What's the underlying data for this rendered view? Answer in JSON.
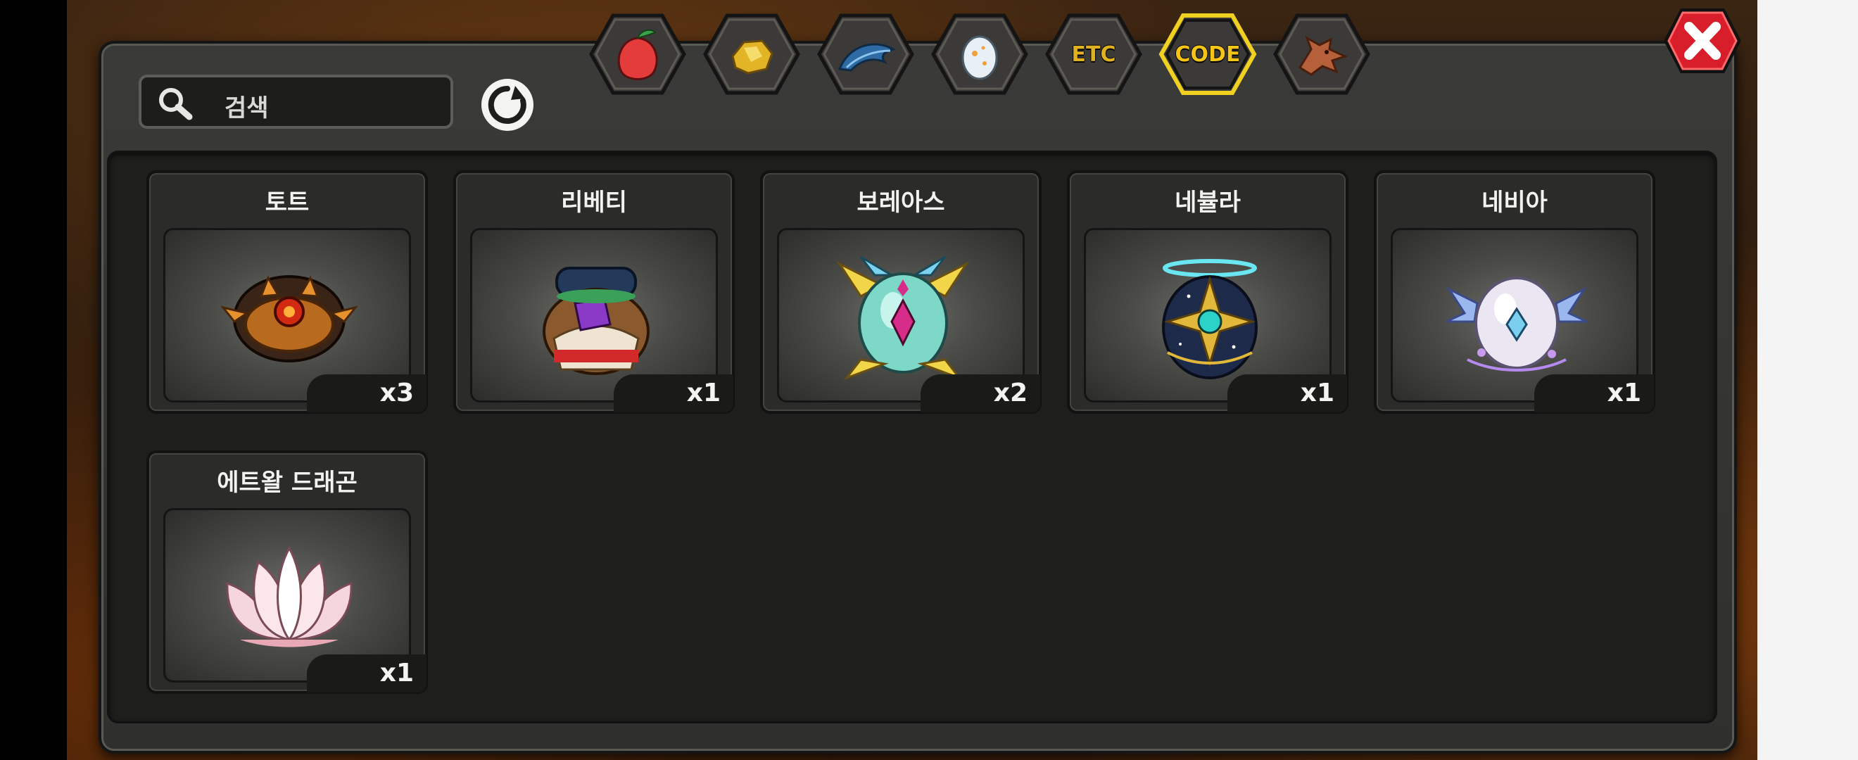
{
  "search": {
    "placeholder": "검색",
    "icon": "magnifier-icon"
  },
  "tabs": [
    {
      "id": "fruit",
      "icon": "fruit-icon"
    },
    {
      "id": "gold",
      "icon": "gold-icon"
    },
    {
      "id": "feather",
      "icon": "feather-icon"
    },
    {
      "id": "egg",
      "icon": "egg-icon"
    },
    {
      "id": "etc",
      "label": "ETC"
    },
    {
      "id": "code",
      "label": "CODE",
      "active": true
    },
    {
      "id": "dragon",
      "icon": "dragon-head-icon"
    }
  ],
  "items": [
    {
      "name": "토트",
      "qty": "x3",
      "icon": "tot-egg-icon"
    },
    {
      "name": "리베티",
      "qty": "x1",
      "icon": "libeti-egg-icon"
    },
    {
      "name": "보레아스",
      "qty": "x2",
      "icon": "boreas-egg-icon"
    },
    {
      "name": "네뷸라",
      "qty": "x1",
      "icon": "nebula-egg-icon"
    },
    {
      "name": "네비아",
      "qty": "x1",
      "icon": "nevia-egg-icon"
    },
    {
      "name": "에트왈 드래곤",
      "qty": "x1",
      "icon": "etoile-lotus-egg-icon"
    }
  ],
  "colors": {
    "active_tab_border": "#f0d020",
    "close_button": "#d81e2a"
  }
}
